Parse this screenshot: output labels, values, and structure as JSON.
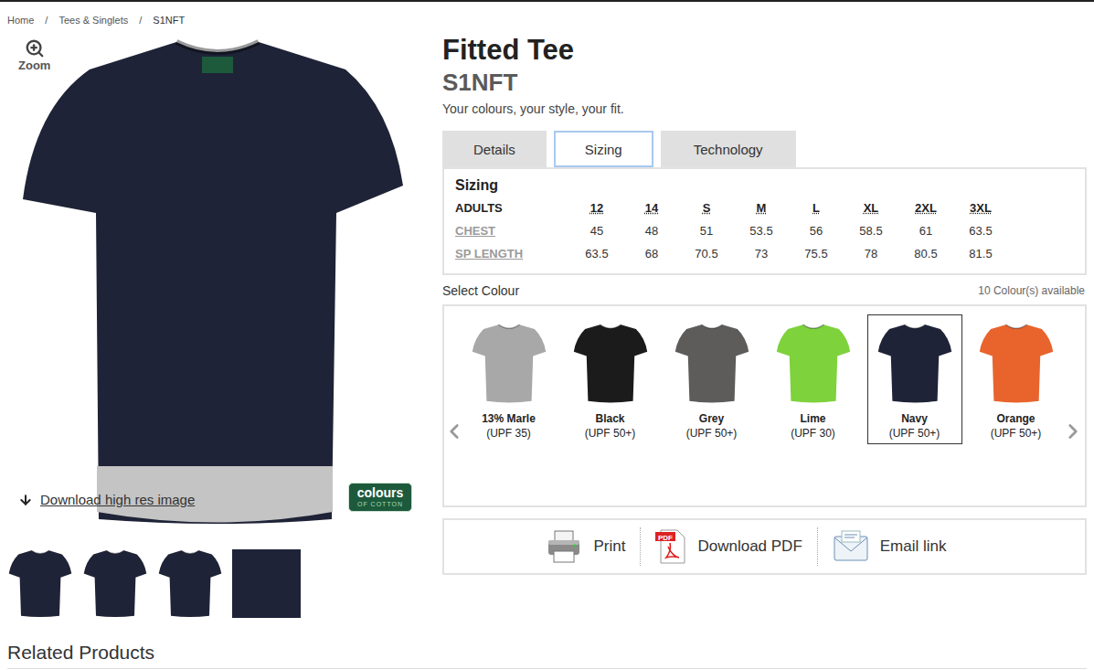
{
  "breadcrumb": {
    "items": [
      "Home",
      "Tees & Singlets",
      "S1NFT"
    ],
    "separator": "/"
  },
  "gallery": {
    "zoom_label": "Zoom",
    "download_label": "Download high res image",
    "logo": {
      "top": "colours",
      "bottom": "OF COTTON"
    },
    "thumbnails": [
      {
        "kind": "shirt"
      },
      {
        "kind": "shirt"
      },
      {
        "kind": "shirt"
      },
      {
        "kind": "swatch"
      }
    ]
  },
  "product": {
    "title": "Fitted Tee",
    "code": "S1NFT",
    "tagline": "Your colours, your style, your fit."
  },
  "tabs": [
    {
      "label": "Details",
      "selected": false
    },
    {
      "label": "Sizing",
      "selected": true
    },
    {
      "label": "Technology",
      "selected": false
    }
  ],
  "sizing": {
    "title": "Sizing",
    "columns": [
      "ADULTS",
      "12",
      "14",
      "S",
      "M",
      "L",
      "XL",
      "2XL",
      "3XL"
    ],
    "rows": [
      {
        "label": "CHEST",
        "values": [
          "45",
          "48",
          "51",
          "53.5",
          "56",
          "58.5",
          "61",
          "63.5"
        ]
      },
      {
        "label": "SP LENGTH",
        "values": [
          "63.5",
          "68",
          "70.5",
          "73",
          "75.5",
          "78",
          "80.5",
          "81.5"
        ]
      }
    ]
  },
  "colours": {
    "label": "Select Colour",
    "count": "10 Colour(s) available",
    "items": [
      {
        "name": "13% Marle",
        "upf": "(UPF 35)",
        "color": "#a8a8a8",
        "selected": false
      },
      {
        "name": "Black",
        "upf": "(UPF 50+)",
        "color": "#1b1b1b",
        "selected": false
      },
      {
        "name": "Grey",
        "upf": "(UPF 50+)",
        "color": "#5e5b5b",
        "selected": false
      },
      {
        "name": "Lime",
        "upf": "(UPF 30)",
        "color": "#7ed23c",
        "selected": false
      },
      {
        "name": "Navy",
        "upf": "(UPF 50+)",
        "color": "#1f2337",
        "selected": true
      },
      {
        "name": "Orange",
        "upf": "(UPF 50+)",
        "color": "#e8642c",
        "selected": false
      }
    ]
  },
  "actions": [
    {
      "label": "Print",
      "kind": "print",
      "icon_text": ""
    },
    {
      "label": "Download PDF",
      "kind": "pdf",
      "icon_text": "PDF"
    },
    {
      "label": "Email link",
      "kind": "email",
      "icon_text": ""
    }
  ],
  "related": {
    "title": "Related Products"
  }
}
